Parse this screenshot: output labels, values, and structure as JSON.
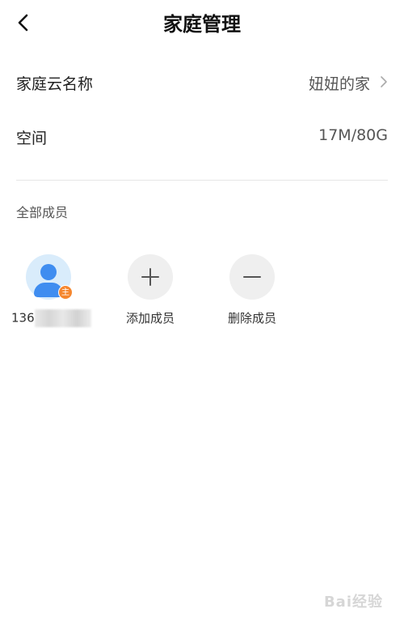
{
  "header": {
    "back_icon": "back-arrow-icon",
    "title": "家庭管理"
  },
  "rows": {
    "family_name_label": "家庭云名称",
    "family_name_value": "妞妞的家",
    "space_label": "空间",
    "space_value": "17M/80G"
  },
  "members_section": {
    "title": "全部成员",
    "owner_badge": "主",
    "owner_phone_prefix": "136",
    "add_label": "添加成员",
    "delete_label": "删除成员"
  },
  "watermark": "Bai经验",
  "colors": {
    "avatar": "#3f8df0",
    "avatar_bg": "#d9ecfb",
    "owner_badge": "#f5862e",
    "action_bg": "#efefef"
  }
}
